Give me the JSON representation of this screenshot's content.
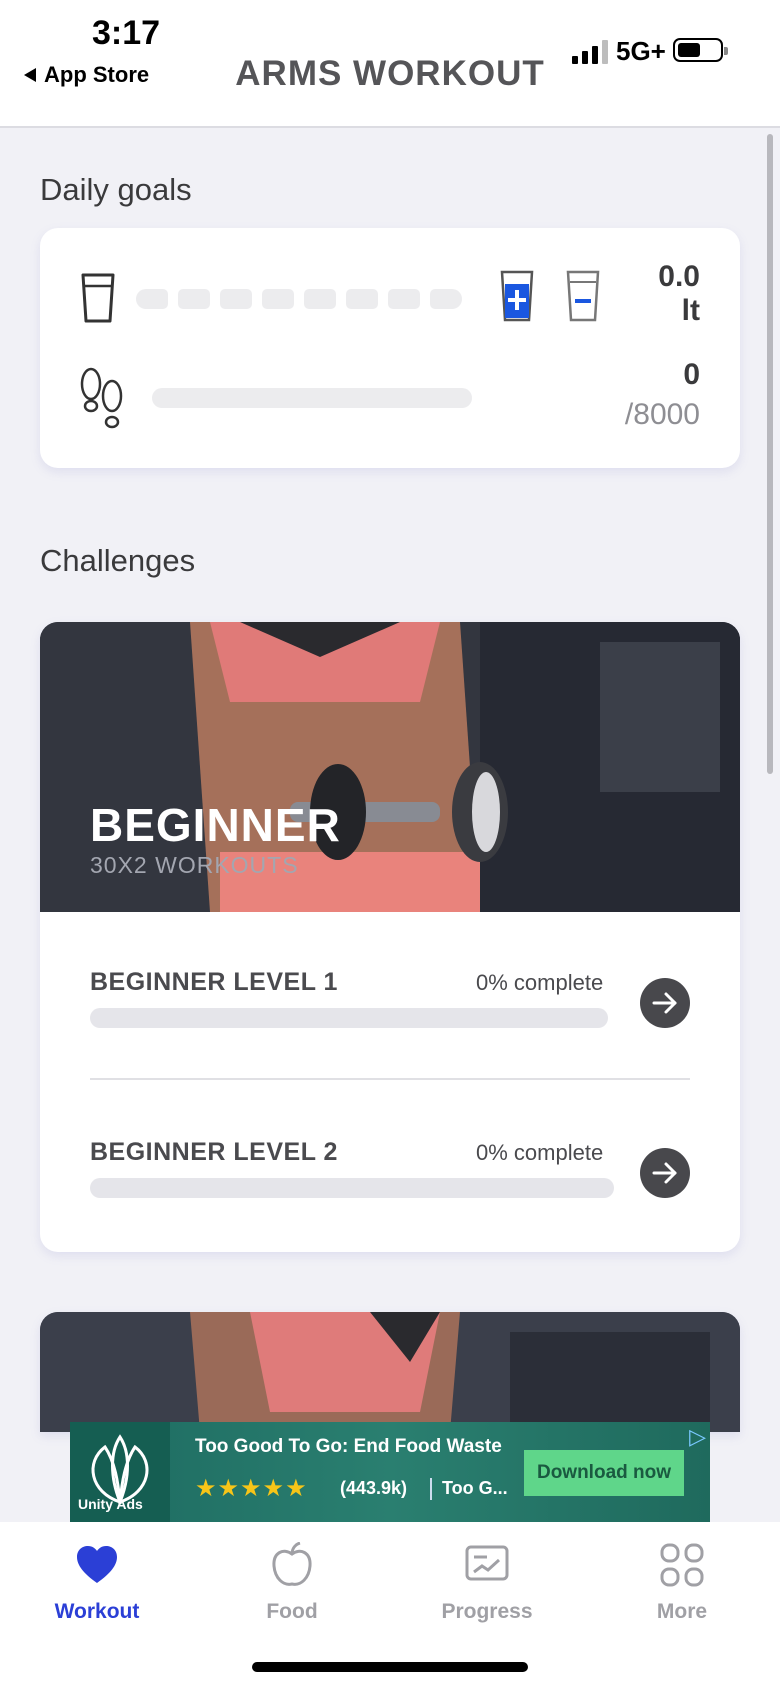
{
  "status": {
    "time": "3:17",
    "back_label": "App Store",
    "network": "5G+"
  },
  "header": {
    "title": "ARMS WORKOUT"
  },
  "daily_goals": {
    "title": "Daily goals",
    "water_value": "0.0",
    "water_unit": "lt",
    "water_filled_segments": 0,
    "water_total_segments": 8,
    "steps_value": "0",
    "steps_goal": "/8000",
    "steps_progress": 0
  },
  "challenges": {
    "title": "Challenges",
    "card": {
      "name": "BEGINNER",
      "subtitle": "30X2 WORKOUTS",
      "levels": [
        {
          "label": "BEGINNER LEVEL 1",
          "percent_text": "0% complete",
          "progress": 0
        },
        {
          "label": "BEGINNER LEVEL 2",
          "percent_text": "0% complete",
          "progress": 0
        }
      ]
    }
  },
  "ad": {
    "title": "Too Good To Go: End Food Waste",
    "stars": "★★★★★",
    "rating_count": "(443.9k)",
    "more": "Too G...",
    "cta": "Download now",
    "network": "Unity Ads"
  },
  "tabbar": {
    "tabs": [
      {
        "label": "Workout",
        "icon": "heart-icon",
        "active": true
      },
      {
        "label": "Food",
        "icon": "apple-icon",
        "active": false
      },
      {
        "label": "Progress",
        "icon": "chart-card-icon",
        "active": false
      },
      {
        "label": "More",
        "icon": "grid-icon",
        "active": false
      }
    ]
  },
  "colors": {
    "accent": "#2b3fd6",
    "plus_button": "#1a57e0",
    "background": "#f1f1f6"
  }
}
